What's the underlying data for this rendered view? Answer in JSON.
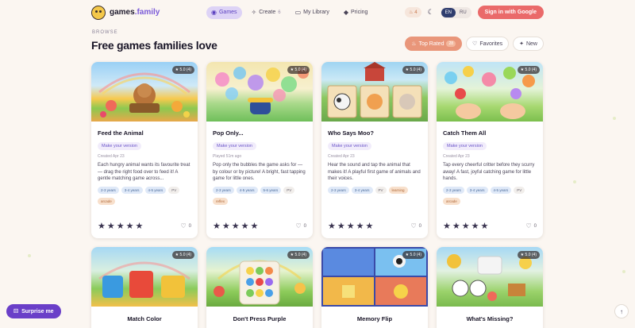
{
  "header": {
    "logo_text": "games",
    "logo_ext": ".family",
    "nav": [
      {
        "label": "Games",
        "icon": "gamepad-icon"
      },
      {
        "label": "Create",
        "icon": "sparkles-icon",
        "count": "6"
      },
      {
        "label": "My Library",
        "icon": "book-icon"
      },
      {
        "label": "Pricing",
        "icon": "diamond-icon"
      }
    ],
    "streak": "4",
    "lang_en": "EN",
    "lang_ru": "RU",
    "signin": "Sign in with Google"
  },
  "browse_label": "BROWSE",
  "page_title": "Free games families love",
  "filters": {
    "top_rated": "Top Rated",
    "top_rated_badge": "28",
    "favorites": "Favorites",
    "new": "New"
  },
  "cards": [
    {
      "title": "Feed the Animal",
      "rating": "★ 5.0 (4)",
      "make": "Make your version",
      "meta": "Created Apr 23",
      "desc": "Each hungry animal wants its favourite treat — drag the right food over to feed it! A gentle matching game across...",
      "tags": [
        "2-3 years",
        "3-4 years",
        "4-5 years",
        "PV",
        "arcade"
      ],
      "likes": "0"
    },
    {
      "title": "Pop Only...",
      "rating": "★ 5.0 (4)",
      "make": "Make your version",
      "meta": "Played 51m ago",
      "desc": "Pop only the bubbles the game asks for — by colour or by picture! A bright, fast tapping game for little ones.",
      "tags": [
        "2-3 years",
        "4-5 years",
        "5-6 years",
        "PV",
        "reflex"
      ],
      "likes": "0"
    },
    {
      "title": "Who Says Moo?",
      "rating": "★ 5.0 (4)",
      "make": "Make your version",
      "meta": "Created Apr 23",
      "desc": "Hear the sound and tap the animal that makes it! A playful first game of animals and their voices.",
      "tags": [
        "2-3 years",
        "3-4 years",
        "PV",
        "learning"
      ],
      "likes": "0"
    },
    {
      "title": "Catch Them All",
      "rating": "★ 5.0 (4)",
      "make": "Make your version",
      "meta": "Created Apr 23",
      "desc": "Tap every cheerful critter before they scurry away! A fast, joyful catching game for little hands.",
      "tags": [
        "2-3 years",
        "3-4 years",
        "4-5 years",
        "PV",
        "arcade"
      ],
      "likes": "0"
    }
  ],
  "cards_row2": [
    {
      "title": "Match Color",
      "rating": "★ 5.0 (4)"
    },
    {
      "title": "Don't Press Purple",
      "rating": "★ 5.0 (4)"
    },
    {
      "title": "Memory Flip",
      "rating": "★ 5.0 (4)"
    },
    {
      "title": "What's Missing?",
      "rating": "★ 5.0 (4)"
    }
  ],
  "stars": "★★★★★",
  "surprise": "Surprise me",
  "colors": {
    "accent": "#6a3fc8",
    "signin": "#ea6a6a",
    "top_rated": "#e9967a"
  }
}
